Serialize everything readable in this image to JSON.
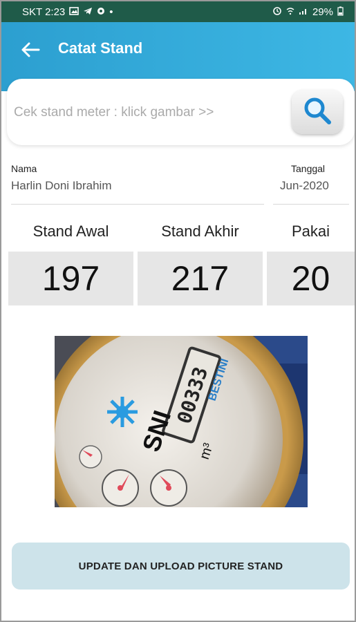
{
  "status_bar": {
    "carrier_time": "SKT 2:23",
    "notif_icons": [
      "gallery-icon",
      "telegram-icon",
      "location-icon"
    ],
    "dot": "•",
    "battery": "29%"
  },
  "app_bar": {
    "title": "Catat Stand",
    "background_color": "#35aedd"
  },
  "search": {
    "placeholder": "Cek stand meter : klick gambar >>",
    "value": ""
  },
  "info": {
    "nama_label": "Nama",
    "nama_value": "Harlin Doni Ibrahim",
    "tanggal_label": "Tanggal",
    "tanggal_value": "Jun-2020"
  },
  "readings": {
    "awal_label": "Stand Awal",
    "awal_value": "197",
    "akhir_label": "Stand Akhir",
    "akhir_value": "217",
    "pakai_label": "Pakai",
    "pakai_value": "20"
  },
  "meter_photo": {
    "brand_text": "BESTINI",
    "mark_text": "SNI",
    "unit_text": "m³",
    "counter_text": "00333"
  },
  "actions": {
    "update_label": "UPDATE DAN UPLOAD PICTURE STAND",
    "update_color": "#cde3ea"
  }
}
